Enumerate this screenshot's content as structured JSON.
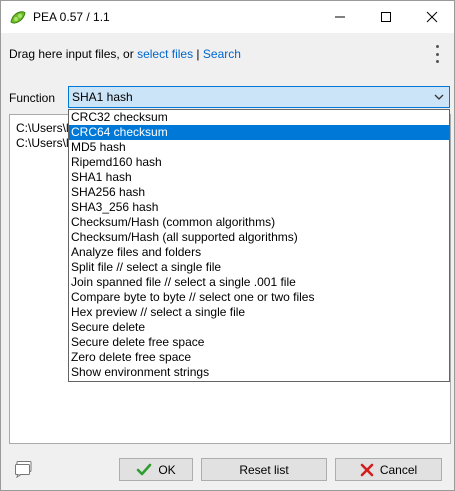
{
  "window": {
    "title": "PEA 0.57 / 1.1"
  },
  "toolbar": {
    "drag_text": "Drag here input files, or ",
    "select_files_link": "select files",
    "separator": " | ",
    "search_link": "Search"
  },
  "function": {
    "label": "Function",
    "selected_value": "SHA1 hash",
    "options": [
      "CRC32 checksum",
      "CRC64 checksum",
      "MD5 hash",
      "Ripemd160 hash",
      "SHA1 hash",
      "SHA256 hash",
      "SHA3_256 hash",
      "Checksum/Hash (common algorithms)",
      "Checksum/Hash (all supported algorithms)",
      "Analyze files and folders",
      "Split file // select a single file",
      "Join spanned file // select a single .001 file",
      "Compare byte to byte // select one or two files",
      "Hex preview // select a single file",
      "Secure delete",
      "Secure delete free space",
      "Zero delete free space",
      "Show environment strings"
    ],
    "highlighted_option": "CRC64 checksum"
  },
  "file_list": {
    "lines": [
      "C:\\Users\\l",
      "C:\\Users\\l"
    ]
  },
  "buttons": {
    "ok": "OK",
    "reset": "Reset list",
    "cancel": "Cancel"
  },
  "colors": {
    "accent": "#0078d7",
    "link": "#0066cc",
    "select_bg": "#cce4f7",
    "ok_check": "#2e9e2e",
    "cancel_x": "#d21e1e"
  }
}
